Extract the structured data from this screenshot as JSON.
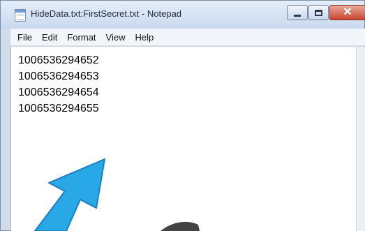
{
  "window": {
    "title": "HideData.txt:FirstSecret.txt - Notepad",
    "controls": {
      "minimize": "minimize",
      "maximize": "maximize",
      "close": "close"
    }
  },
  "menubar": {
    "items": [
      {
        "label": "File"
      },
      {
        "label": "Edit"
      },
      {
        "label": "Format"
      },
      {
        "label": "View"
      },
      {
        "label": "Help"
      }
    ]
  },
  "editor": {
    "lines": [
      "1006536294652",
      "1006536294653",
      "1006536294654",
      "1006536294655"
    ]
  },
  "colors": {
    "arrow": "#29a8e8",
    "close_button": "#c9452f",
    "titlebar": "#d6e3f3"
  },
  "icons": [
    "notepad-icon",
    "minimize-icon",
    "maximize-icon",
    "close-icon",
    "pointer-arrow-icon"
  ]
}
